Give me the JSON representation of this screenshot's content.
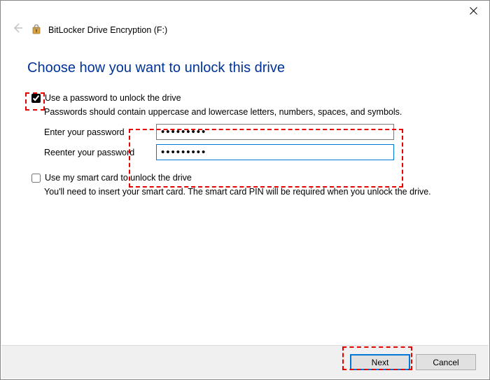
{
  "window": {
    "title": "BitLocker Drive Encryption (F:)"
  },
  "heading": "Choose how you want to unlock this drive",
  "option_password": {
    "label": "Use a password to unlock the drive",
    "checked": true,
    "help": "Passwords should contain uppercase and lowercase letters, numbers, spaces, and symbols.",
    "enter_label": "Enter your password",
    "reenter_label": "Reenter your password",
    "password_value": "•••••••••",
    "password_confirm_value": "•••••••••"
  },
  "option_smartcard": {
    "label": "Use my smart card to unlock the drive",
    "checked": false,
    "help": "You'll need to insert your smart card. The smart card PIN will be required when you unlock the drive."
  },
  "buttons": {
    "next": "Next",
    "cancel": "Cancel"
  }
}
